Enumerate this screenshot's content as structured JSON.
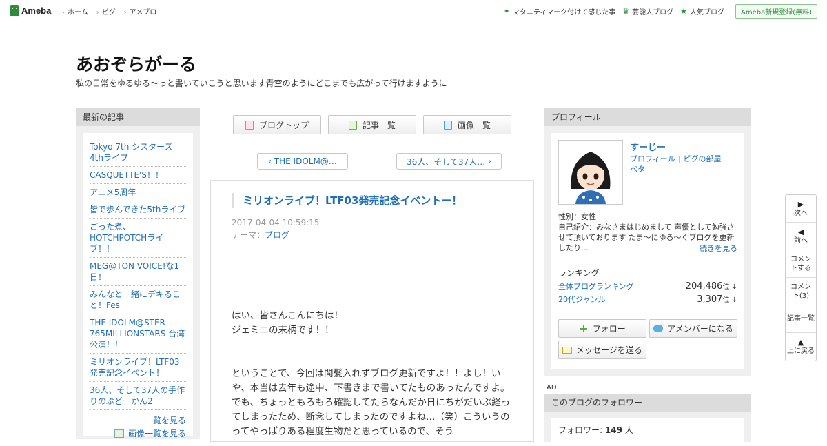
{
  "gnav": {
    "logo": "Ameba",
    "links": [
      "ホーム",
      "ピグ",
      "アメブロ"
    ],
    "right_links": [
      "マタニティマーク付けて感じた事",
      "芸能人ブログ",
      "人気ブログ"
    ],
    "signup": "Ameba新規登録(無料)"
  },
  "blog": {
    "title": "あおぞらがーる",
    "description": "私の日常をゆるゆる～っと書いていこうと思います青空のようにどこまでも広がって行けますように"
  },
  "recent": {
    "heading": "最新の記事",
    "items": [
      "Tokyo 7th シスターズ4thライブ",
      "CASQUETTE'S！！",
      "アニメ5周年",
      "皆で歩んできた5thライブ",
      "ごった煮、HOTCHPOTCHライブ！！",
      "MEG@TON VOICE!な1日！",
      "みんなと一緒にデキること！Fes",
      "THE IDOLM@STER 765MILLIONSTARS 台湾公演！！",
      "ミリオンライブ！LTF03発売記念イベント！",
      "36人、そして37人の手作りのぷどーかん2"
    ],
    "see_all": "一覧を見る",
    "see_images": "画像一覧を見る"
  },
  "toolbar": {
    "blog_top": "ブログトップ",
    "article_list": "記事一覧",
    "image_list": "画像一覧"
  },
  "pager": {
    "prev": "THE IDOLM@…",
    "next": "36人、そして37人…"
  },
  "article": {
    "title": "ミリオンライブ！LTF03発売記念イベントー！",
    "date": "2017-04-04 10:59:15",
    "theme_label": "テーマ：",
    "theme": "ブログ",
    "para1": [
      "はい、皆さんこんにちは！",
      "ジェミニの末柄です！！"
    ],
    "para2": "ということで、今回は間髪入れずブログ更新ですよ！！よし！いや、本当は去年も途中、下書きまで書いてたものあったんですよ。でも、ちょっともろもろ確認してたらなんだか日にちがだいぶ経ってしまったため、断念してしまったのですよね…（笑）こういうのってやっぱりある程度生物だと思っているので、そう"
  },
  "profile": {
    "heading": "プロフィール",
    "name": "すーじー",
    "link_profile": "プロフィール",
    "link_room": "ピグの部屋",
    "link_peta": "ペタ",
    "gender": "性別：女性",
    "intro": "自己紹介：みなさまはじめまして 声優として勉強させて頂いております たま～にゆる～くブログを更新したり...",
    "continue": "続きを見る",
    "ranking_heading": "ランキング",
    "rank1_label": "全体ブログランキング",
    "rank1_value": "204,486",
    "rank2_label": "20代ジャンル",
    "rank2_value": "3,307",
    "rank_unit": "位",
    "follow": "フォロー",
    "amember": "アメンバーになる",
    "message": "メッセージを送る"
  },
  "ad_label": "AD",
  "followers": {
    "heading": "このブログのフォロワー",
    "label": "フォロワー:",
    "count": "149",
    "unit": "人"
  },
  "float_nav": {
    "next": "次へ",
    "prev": "前へ",
    "comment_do": "コメントする",
    "comment_count": "コメント(3)",
    "article_list": "記事一覧",
    "to_top": "上に戻る"
  }
}
